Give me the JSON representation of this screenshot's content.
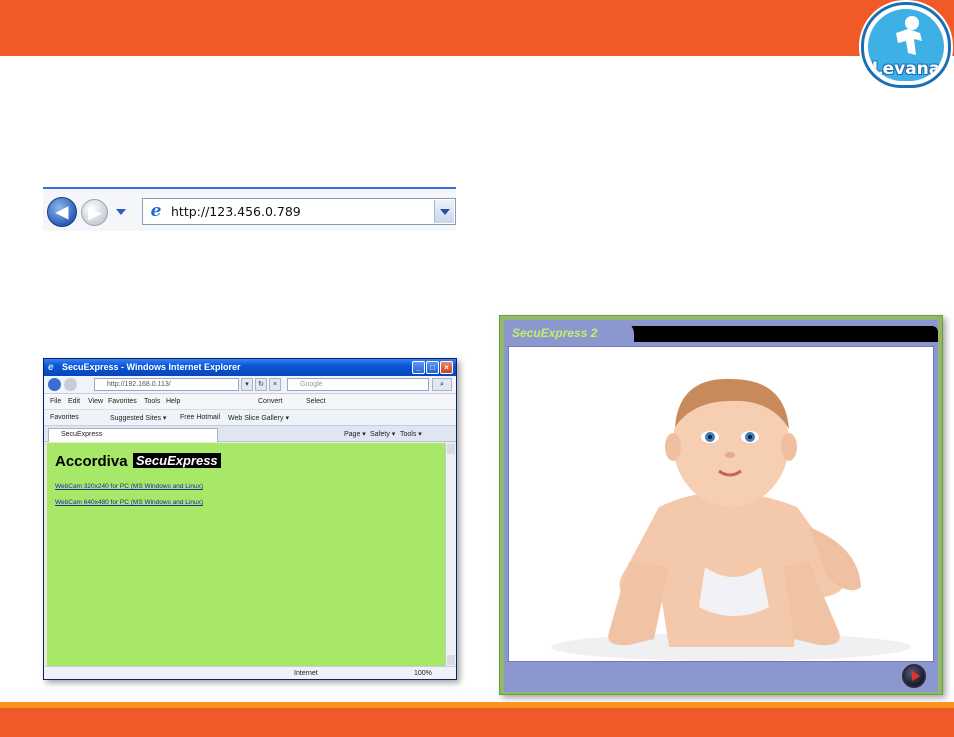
{
  "logo": {
    "text": "Levana"
  },
  "address_bar": {
    "url": "http://123.456.0.789",
    "icons": [
      "back-icon",
      "forward-icon",
      "ie-icon",
      "dropdown-icon"
    ]
  },
  "ie_window": {
    "title": "SecuExpress - Windows Internet Explorer",
    "url": "http://192.168.0.113/",
    "search_placeholder": "Google",
    "menu": [
      "File",
      "Edit",
      "View",
      "Favorites",
      "Tools",
      "Help"
    ],
    "menu_extra": [
      "Convert",
      "Select"
    ],
    "favorites": {
      "label": "Favorites",
      "items": [
        "Suggested Sites ▾",
        "Free Hotmail",
        "Web Slice Gallery ▾"
      ]
    },
    "tab_label": "SecuExpress",
    "tab_tools": [
      "Page ▾",
      "Safety ▾",
      "Tools ▾"
    ],
    "content": {
      "heading": "Accordiva",
      "brand": "SecuExpress",
      "links": [
        "WebCam 320x240 for PC (MS Windows and Linux)",
        "WebCam 640x480 for PC (MS Windows and Linux)"
      ]
    },
    "status": {
      "zone": "Internet",
      "zoom": "100%"
    },
    "colors": {
      "content_bg": "#a8e868",
      "titlebar": "#0a56d8"
    }
  },
  "player": {
    "title": "SecuExpress 2",
    "colors": {
      "frame": "#8d97cf",
      "border": "#8fb868",
      "title": "#bff06a"
    }
  },
  "colors": {
    "accent": "#f05a28",
    "accent_light": "#f7931e"
  }
}
